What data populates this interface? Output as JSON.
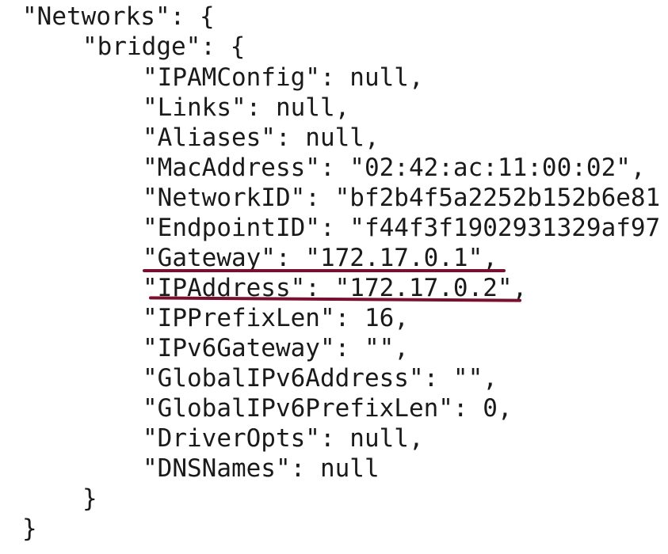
{
  "code": {
    "lines": [
      "\"Networks\": {",
      "\"bridge\": {",
      "\"IPAMConfig\": null,",
      "\"Links\": null,",
      "\"Aliases\": null,",
      "\"MacAddress\": \"02:42:ac:11:00:02\",",
      "\"NetworkID\": \"bf2b4f5a2252b152b6e81",
      "\"EndpointID\": \"f44f3f1902931329af97",
      "\"Gateway\": \"172.17.0.1\",",
      "\"IPAddress\": \"172.17.0.2\",",
      "\"IPPrefixLen\": 16,",
      "\"IPv6Gateway\": \"\",",
      "\"GlobalIPv6Address\": \"\",",
      "\"GlobalIPv6PrefixLen\": 0,",
      "\"DriverOpts\": null,",
      "\"DNSNames\": null",
      "}",
      "}"
    ]
  },
  "highlight_color": "#7a1030"
}
